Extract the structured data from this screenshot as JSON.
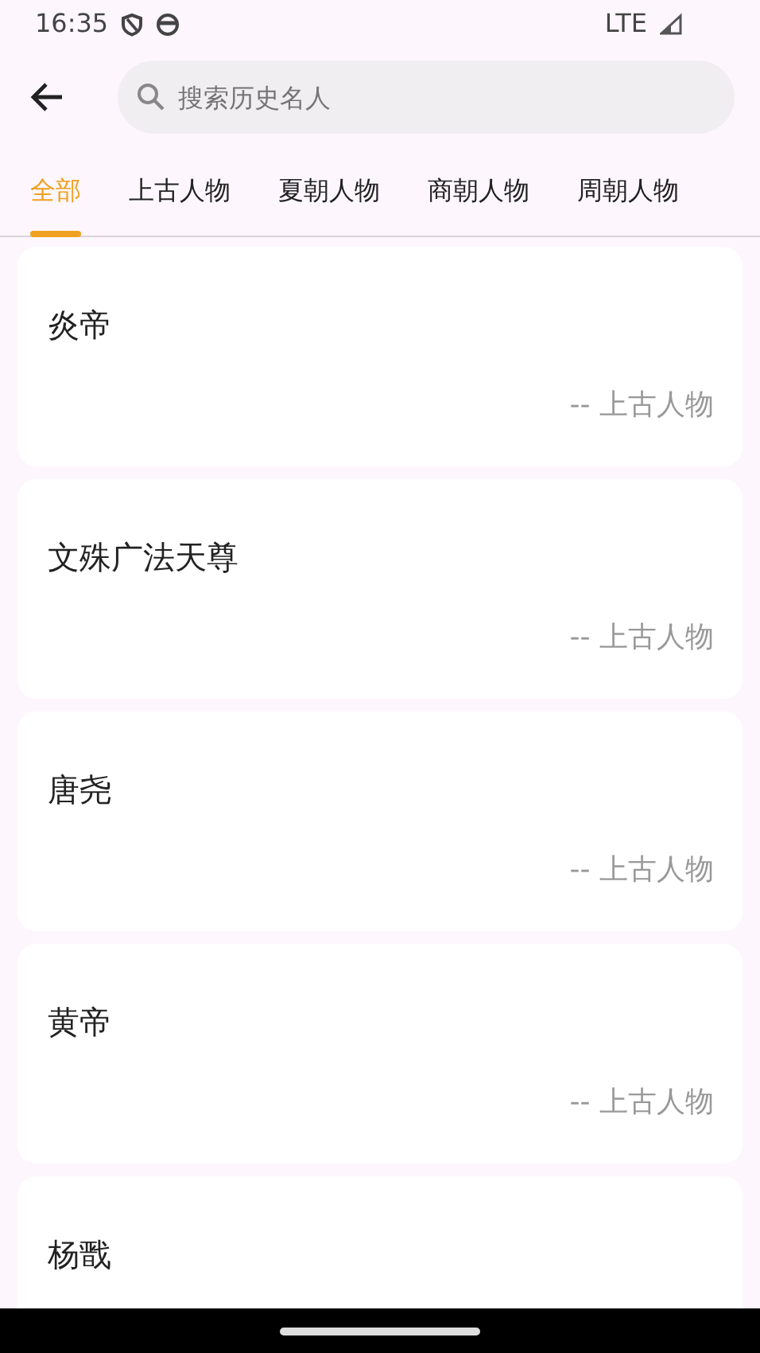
{
  "status_bar": {
    "time": "16:35",
    "network": "LTE"
  },
  "search": {
    "placeholder": "搜索历史名人"
  },
  "tabs": [
    {
      "label": "全部",
      "selected": true
    },
    {
      "label": "上古人物",
      "selected": false
    },
    {
      "label": "夏朝人物",
      "selected": false
    },
    {
      "label": "商朝人物",
      "selected": false
    },
    {
      "label": "周朝人物",
      "selected": false
    }
  ],
  "people": [
    {
      "name": "炎帝",
      "category": "-- 上古人物"
    },
    {
      "name": "文殊广法天尊",
      "category": "-- 上古人物"
    },
    {
      "name": "唐尧",
      "category": "-- 上古人物"
    },
    {
      "name": "黄帝",
      "category": "-- 上古人物"
    },
    {
      "name": "杨戬"
    }
  ]
}
